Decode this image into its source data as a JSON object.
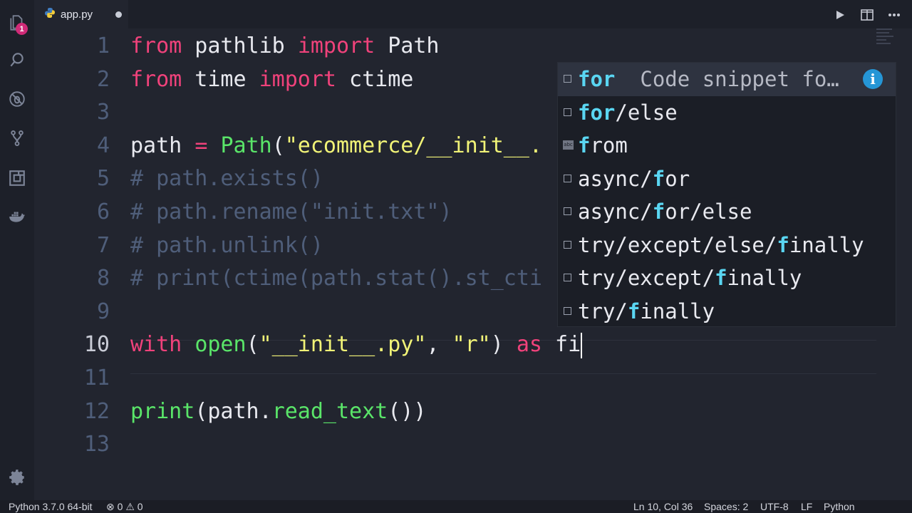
{
  "tab": {
    "filename": "app.py"
  },
  "activity": {
    "badge_count": "1"
  },
  "editor": {
    "lines": [
      {
        "num": "1",
        "tokens": [
          {
            "c": "kw",
            "t": "from"
          },
          {
            "c": "",
            "t": " pathlib "
          },
          {
            "c": "kw",
            "t": "import"
          },
          {
            "c": "",
            "t": " Path"
          }
        ]
      },
      {
        "num": "2",
        "tokens": [
          {
            "c": "kw",
            "t": "from"
          },
          {
            "c": "",
            "t": " time "
          },
          {
            "c": "kw",
            "t": "import"
          },
          {
            "c": "",
            "t": " ctime"
          }
        ]
      },
      {
        "num": "3",
        "tokens": []
      },
      {
        "num": "4",
        "tokens": [
          {
            "c": "",
            "t": "path "
          },
          {
            "c": "kw",
            "t": "="
          },
          {
            "c": "",
            "t": " "
          },
          {
            "c": "fn",
            "t": "Path"
          },
          {
            "c": "",
            "t": "("
          },
          {
            "c": "str",
            "t": "\"ecommerce/__init__."
          }
        ]
      },
      {
        "num": "5",
        "tokens": [
          {
            "c": "cmt",
            "t": "# path.exists()"
          }
        ]
      },
      {
        "num": "6",
        "tokens": [
          {
            "c": "cmt",
            "t": "# path.rename(\"init.txt\")"
          }
        ]
      },
      {
        "num": "7",
        "tokens": [
          {
            "c": "cmt",
            "t": "# path.unlink()"
          }
        ]
      },
      {
        "num": "8",
        "tokens": [
          {
            "c": "cmt",
            "t": "# print(ctime(path.stat().st_cti"
          }
        ]
      },
      {
        "num": "9",
        "tokens": []
      },
      {
        "num": "10",
        "tokens": [
          {
            "c": "kw",
            "t": "with"
          },
          {
            "c": "",
            "t": " "
          },
          {
            "c": "fn",
            "t": "open"
          },
          {
            "c": "",
            "t": "("
          },
          {
            "c": "str",
            "t": "\"__init__.py\""
          },
          {
            "c": "",
            "t": ", "
          },
          {
            "c": "str",
            "t": "\"r\""
          },
          {
            "c": "",
            "t": ") "
          },
          {
            "c": "kw",
            "t": "as"
          },
          {
            "c": "",
            "t": " fi"
          }
        ]
      },
      {
        "num": "11",
        "tokens": []
      },
      {
        "num": "12",
        "tokens": [
          {
            "c": "fn",
            "t": "print"
          },
          {
            "c": "",
            "t": "(path."
          },
          {
            "c": "fn",
            "t": "read_text"
          },
          {
            "c": "",
            "t": "())"
          }
        ]
      },
      {
        "num": "13",
        "tokens": []
      }
    ],
    "active_line": "10"
  },
  "suggestions": {
    "items": [
      {
        "pre": "",
        "match": "for",
        "post": "",
        "icon": "snippet-icon",
        "detail": "Code snippet fo…"
      },
      {
        "pre": "",
        "match": "for",
        "post": "/else",
        "icon": "snippet-icon"
      },
      {
        "pre": "",
        "match": "f",
        "post": "rom",
        "icon": "keyword-icon",
        "icon_text": "abc"
      },
      {
        "pre": "async/",
        "match": "f",
        "post": "or",
        "icon": "snippet-icon"
      },
      {
        "pre": "async/",
        "match": "f",
        "post": "or/else",
        "icon": "snippet-icon"
      },
      {
        "pre": "try/except/else/",
        "match": "f",
        "post": "inally",
        "icon": "snippet-icon"
      },
      {
        "pre": "try/except/",
        "match": "f",
        "post": "inally",
        "icon": "snippet-icon"
      },
      {
        "pre": "try/",
        "match": "f",
        "post": "inally",
        "icon": "snippet-icon"
      }
    ],
    "info_glyph": "i"
  },
  "status": {
    "interpreter": "Python 3.7.0 64-bit",
    "errors": "0",
    "warnings": "0",
    "position": "Ln 10, Col 36",
    "spaces": "Spaces: 2",
    "encoding": "UTF-8",
    "eol": "LF",
    "language": "Python"
  }
}
